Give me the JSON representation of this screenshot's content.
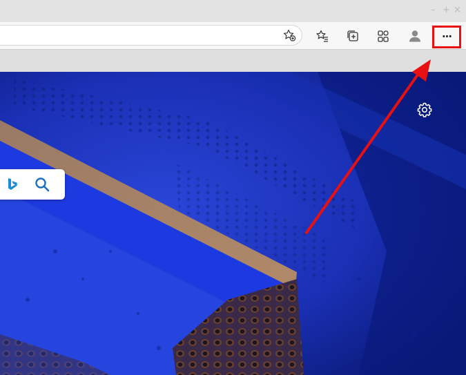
{
  "window_controls": {
    "minimize": "–",
    "maximize": "+",
    "close": "×"
  },
  "toolbar": {
    "add_favorite_icon": "star-plus-icon",
    "favorites_icon": "favorites-list-icon",
    "collections_icon": "collections-icon",
    "extensions_icon": "extensions-icon",
    "profile_icon": "profile-icon",
    "more_label": "···"
  },
  "new_tab_page": {
    "settings_icon": "gear-icon",
    "search_icons": [
      "bing-logo-icon",
      "search-icon"
    ]
  },
  "annotation": {
    "highlight_color": "#e81010",
    "arrow_color": "#e81010"
  }
}
